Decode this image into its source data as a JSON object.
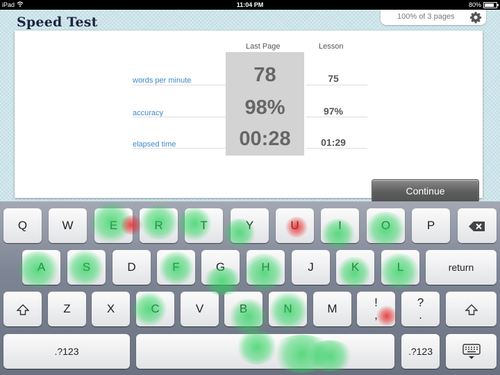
{
  "status_bar": {
    "device": "iPad",
    "time": "11:04 PM",
    "battery": "80%"
  },
  "app": {
    "title": "Speed Test",
    "progress_text": "100% of 3 pages",
    "columns": {
      "last_page": "Last Page",
      "lesson": "Lesson"
    },
    "metrics": [
      {
        "label": "words per minute",
        "last_page": "78",
        "lesson": "75"
      },
      {
        "label": "accuracy",
        "last_page": "98%",
        "lesson": "97%"
      },
      {
        "label": "elapsed time",
        "last_page": "00:28",
        "lesson": "01:29"
      }
    ],
    "continue_label": "Continue"
  },
  "keyboard": {
    "row1": [
      "Q",
      "W",
      "E",
      "R",
      "T",
      "Y",
      "U",
      "I",
      "O",
      "P"
    ],
    "row2": [
      "A",
      "S",
      "D",
      "F",
      "G",
      "H",
      "J",
      "K",
      "L"
    ],
    "return_label": "return",
    "row3": [
      "Z",
      "X",
      "C",
      "V",
      "B",
      "N",
      "M"
    ],
    "punct1": "!\n,",
    "punct2": "?\n.",
    "numbers_label": ".?123"
  },
  "colors": {
    "accent_blue": "#3d89c6",
    "title": "#1c2440",
    "heat_green": "#28d25a",
    "heat_red": "#e62828"
  }
}
